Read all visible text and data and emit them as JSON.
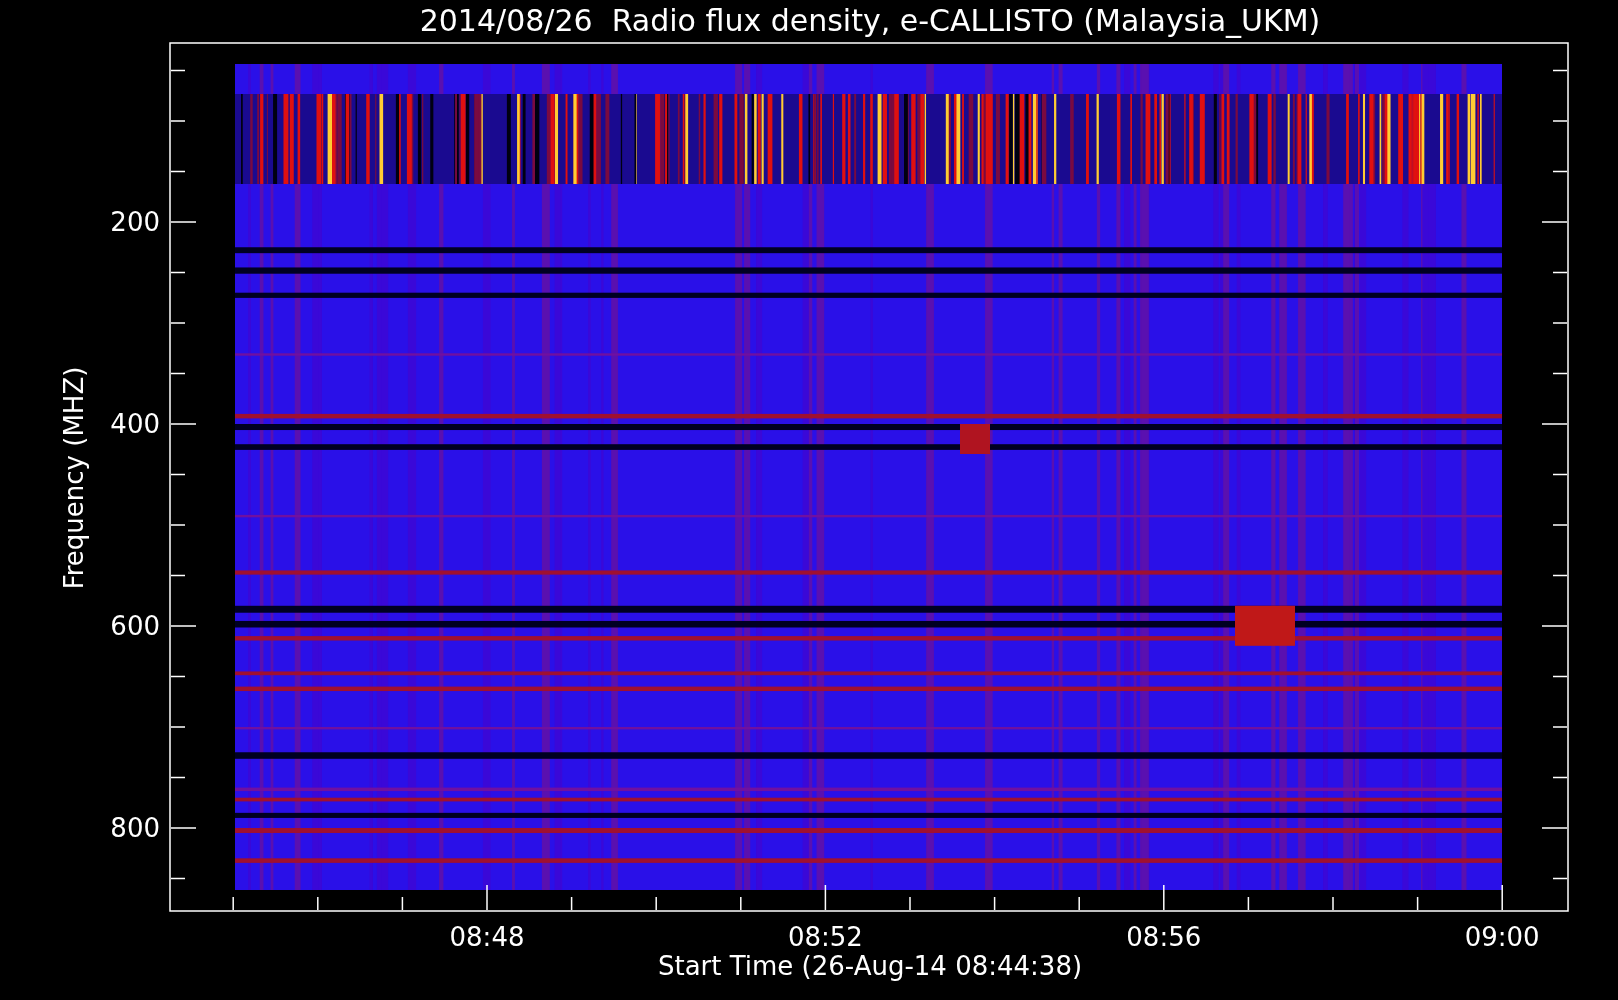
{
  "chart": {
    "title": "2014/08/26  Radio flux density, e-CALLISTO (Malaysia_UKM)",
    "xlabel": "Start Time (26-Aug-14 08:44:38)",
    "ylabel": "Frequency (MHZ)",
    "yticks": [
      "200",
      "400",
      "600",
      "800"
    ],
    "xticks": [
      "08:48",
      "08:52",
      "08:56",
      "09:00"
    ]
  }
}
